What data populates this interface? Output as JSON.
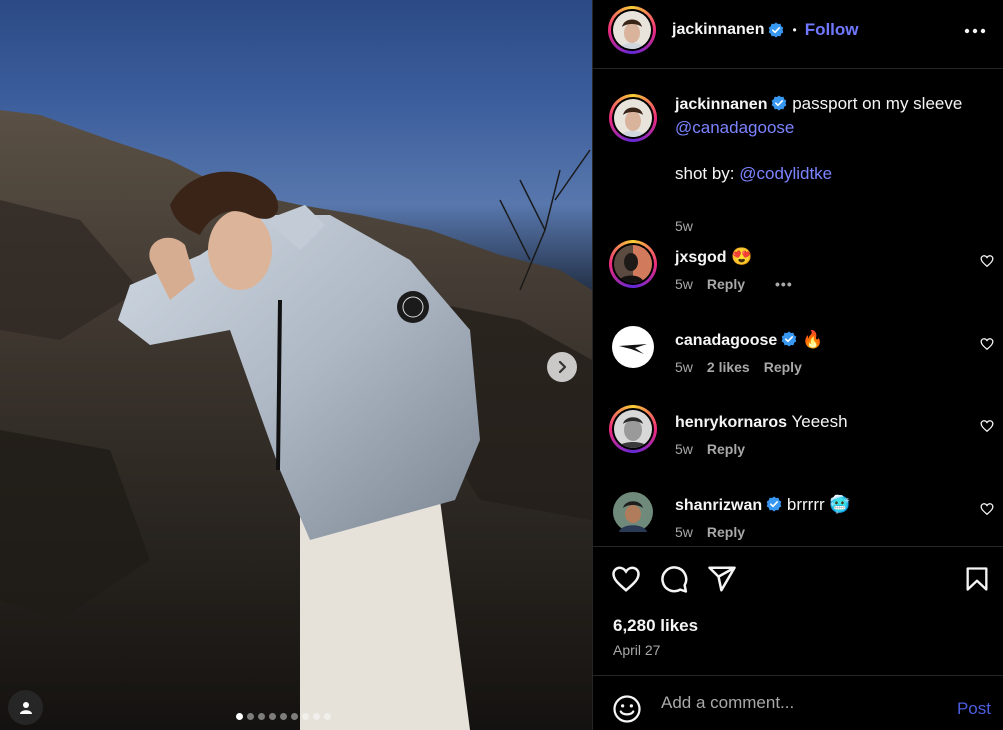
{
  "post": {
    "author": "jackinnanen",
    "follow_label": "Follow",
    "separator": "•",
    "caption_line1": "passport on my sleeve",
    "caption_mention": "@canadagoose",
    "caption_shot_by": "shot by:",
    "caption_shot_mention": "@codylidtke",
    "caption_time": "5w",
    "likes": "6,280 likes",
    "date": "April 27",
    "carousel_total": 9,
    "carousel_index": 1
  },
  "comments": [
    {
      "user": "jxsgod",
      "text": "",
      "emoji": "😍",
      "time": "5w",
      "likes": "",
      "reply": "Reply",
      "more": "•••"
    },
    {
      "user": "canadagoose",
      "text": "",
      "emoji": "🔥",
      "time": "5w",
      "likes": "2 likes",
      "reply": "Reply"
    },
    {
      "user": "henrykornaros",
      "text": "Yeeesh",
      "time": "5w",
      "likes": "",
      "reply": "Reply"
    },
    {
      "user": "shanrizwan",
      "text": "brrrrr",
      "emoji": "🥶",
      "time": "5w",
      "likes": "",
      "reply": "Reply"
    }
  ],
  "composer": {
    "placeholder": "Add a comment...",
    "post_label": "Post"
  },
  "colors": {
    "accent": "#6f78ff",
    "verified": "#3897f0",
    "post_button": "#4c5de0"
  },
  "icons": [
    "more-horizontal-icon",
    "verified-badge-icon",
    "heart-icon",
    "comment-icon",
    "share-icon",
    "bookmark-icon",
    "emoji-icon",
    "user-tag-icon",
    "chevron-right-icon"
  ]
}
